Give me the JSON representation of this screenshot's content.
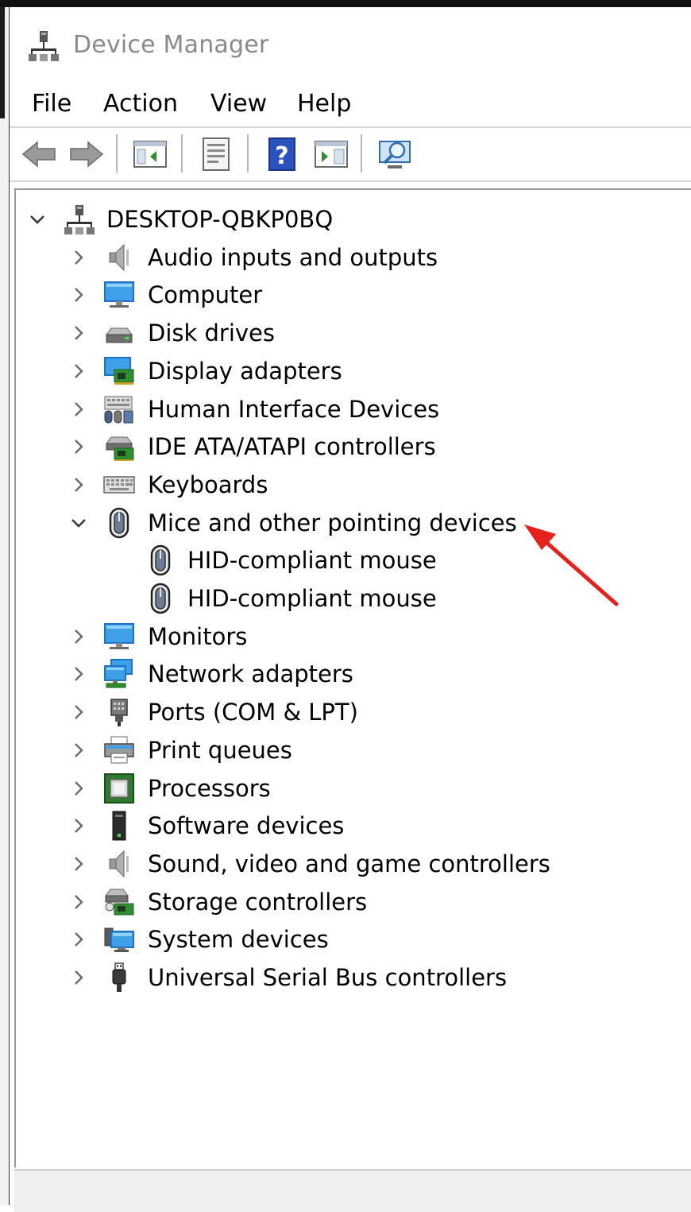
{
  "window": {
    "title": "Device Manager"
  },
  "menu": [
    "File",
    "Action",
    "View",
    "Help"
  ],
  "toolbar": [
    {
      "name": "back-button-icon"
    },
    {
      "name": "forward-button-icon"
    },
    {
      "name": "show-hide-console-tree-icon"
    },
    {
      "name": "properties-icon"
    },
    {
      "name": "help-icon"
    },
    {
      "name": "show-action-pane-icon"
    },
    {
      "name": "scan-hardware-changes-icon"
    }
  ],
  "tree": {
    "root": {
      "label": "DESKTOP-QBKP0BQ",
      "expanded": true,
      "icon": "computer-root-icon"
    },
    "items": [
      {
        "label": "Audio inputs and outputs",
        "icon": "speaker-icon",
        "expanded": false
      },
      {
        "label": "Computer",
        "icon": "monitor-icon",
        "expanded": false
      },
      {
        "label": "Disk drives",
        "icon": "disk-drive-icon",
        "expanded": false
      },
      {
        "label": "Display adapters",
        "icon": "display-adapter-icon",
        "expanded": false
      },
      {
        "label": "Human Interface Devices",
        "icon": "hid-icon",
        "expanded": false
      },
      {
        "label": "IDE ATA/ATAPI controllers",
        "icon": "ide-controller-icon",
        "expanded": false
      },
      {
        "label": "Keyboards",
        "icon": "keyboard-icon",
        "expanded": false
      },
      {
        "label": "Mice and other pointing devices",
        "icon": "mouse-icon",
        "expanded": true,
        "children": [
          {
            "label": "HID-compliant mouse",
            "icon": "mouse-icon"
          },
          {
            "label": "HID-compliant mouse",
            "icon": "mouse-icon"
          }
        ]
      },
      {
        "label": "Monitors",
        "icon": "monitor-icon",
        "expanded": false
      },
      {
        "label": "Network adapters",
        "icon": "network-adapter-icon",
        "expanded": false
      },
      {
        "label": "Ports (COM & LPT)",
        "icon": "port-icon",
        "expanded": false
      },
      {
        "label": "Print queues",
        "icon": "printer-icon",
        "expanded": false
      },
      {
        "label": "Processors",
        "icon": "processor-icon",
        "expanded": false
      },
      {
        "label": "Software devices",
        "icon": "software-device-icon",
        "expanded": false
      },
      {
        "label": "Sound, video and game controllers",
        "icon": "speaker-icon",
        "expanded": false
      },
      {
        "label": "Storage controllers",
        "icon": "storage-controller-icon",
        "expanded": false
      },
      {
        "label": "System devices",
        "icon": "system-devices-icon",
        "expanded": false
      },
      {
        "label": "Universal Serial Bus controllers",
        "icon": "usb-icon",
        "expanded": false
      }
    ]
  },
  "annotation": {
    "type": "arrow",
    "color": "#e8201c",
    "target": "Mice and other pointing devices"
  },
  "colors": {
    "title_text": "#8a8a8a",
    "accent_blue": "#1e73c8",
    "annotation_red": "#e8201c"
  }
}
